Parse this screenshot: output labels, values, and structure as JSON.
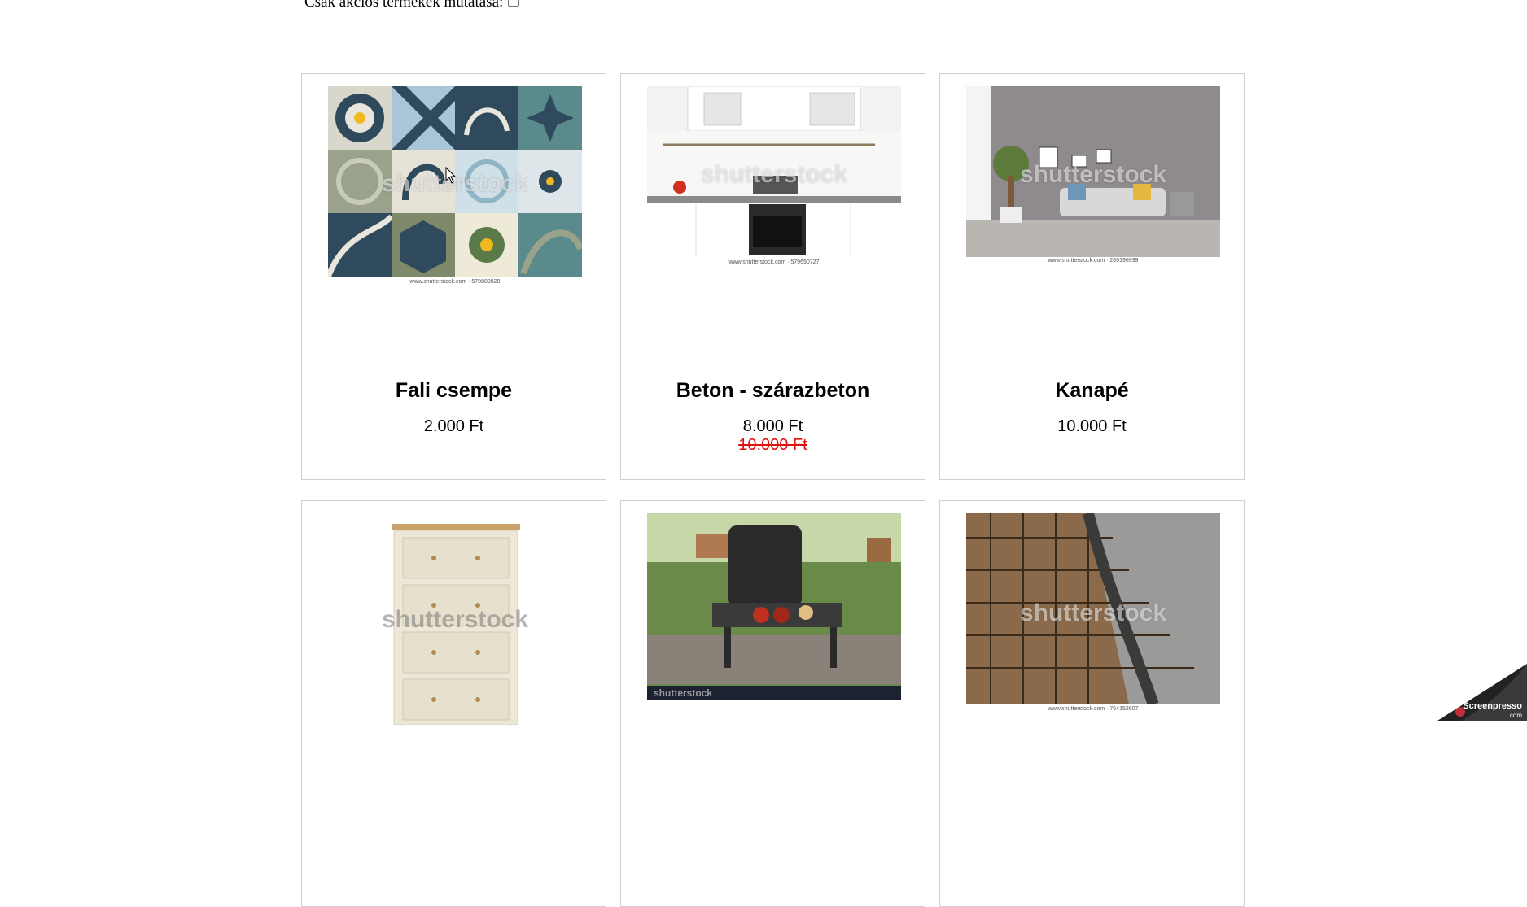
{
  "filter": {
    "label": "Csak akciós termékek mutatása:",
    "checked": false
  },
  "products": [
    {
      "title": "Fali csempe",
      "price": "2.000 Ft",
      "old_price": "",
      "image": "patterned-tiles-image",
      "watermark": "shutterstock",
      "caption": "www.shutterstock.com · 570889828"
    },
    {
      "title": "Beton - szárazbeton",
      "price": "8.000 Ft",
      "old_price": "10.000 Ft",
      "image": "kitchen-image",
      "watermark": "shutterstock",
      "caption": "www.shutterstock.com · 579690727"
    },
    {
      "title": "Kanapé",
      "price": "10.000 Ft",
      "old_price": "",
      "image": "living-room-sofa-image",
      "watermark": "shutterstock",
      "caption": "www.shutterstock.com · 289196939"
    },
    {
      "title": "",
      "price": "",
      "old_price": "",
      "image": "chest-of-drawers-image",
      "watermark": "shutterstock",
      "caption": ""
    },
    {
      "title": "",
      "price": "",
      "old_price": "",
      "image": "grill-image",
      "watermark": "shutterstock",
      "caption": ""
    },
    {
      "title": "",
      "price": "",
      "old_price": "",
      "image": "rebar-concrete-image",
      "watermark": "shutterstock",
      "caption": "www.shutterstock.com · 764152607"
    }
  ],
  "overlay": {
    "brand": "Screenpresso",
    "sub": ".com",
    "icon": "screenpresso-logo-icon"
  },
  "colors": {
    "border": "#cfcfcf",
    "sale_price": "#e01010"
  }
}
